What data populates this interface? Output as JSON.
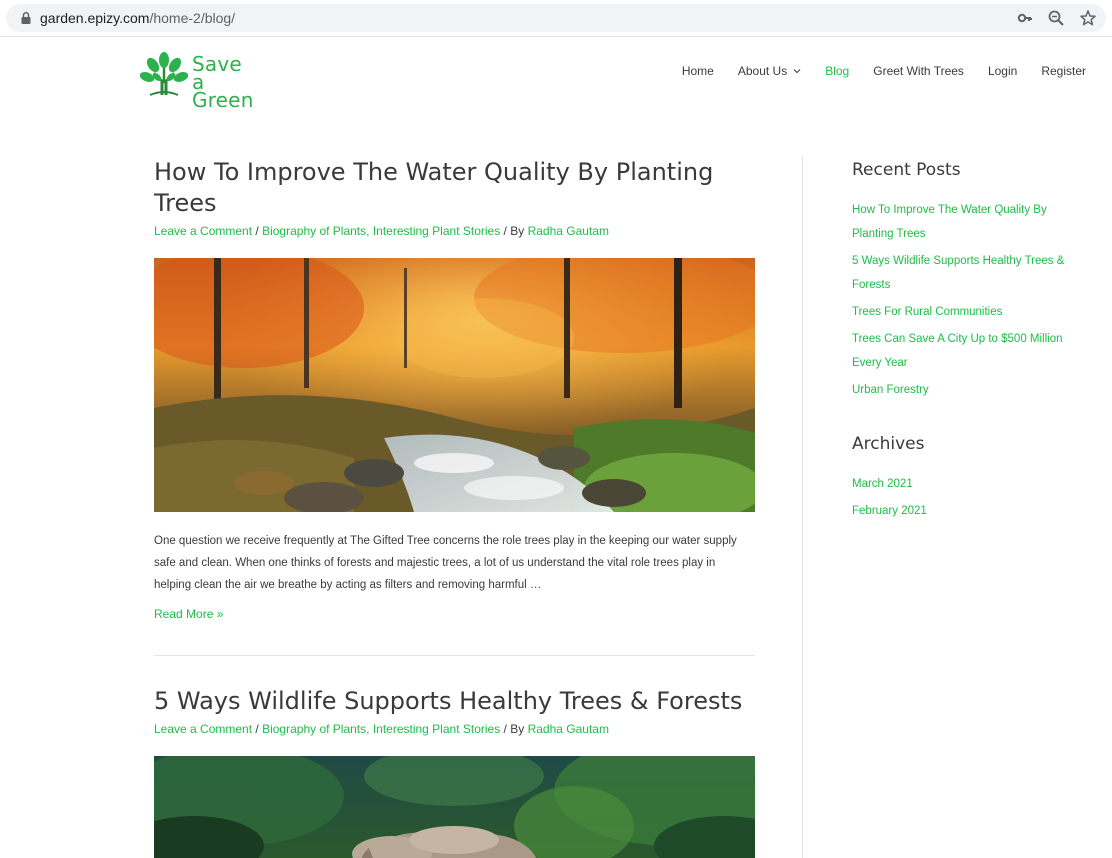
{
  "browser": {
    "url_domain": "garden.epizy.com",
    "url_path": "/home-2/blog/"
  },
  "site": {
    "logo_line1": "Save a",
    "logo_line2": "Green",
    "brand_color": "#2bb24c",
    "link_color": "#1fbd47"
  },
  "nav": {
    "items": [
      {
        "label": "Home"
      },
      {
        "label": "About Us"
      },
      {
        "label": "Blog"
      },
      {
        "label": "Greet With Trees"
      },
      {
        "label": "Login"
      },
      {
        "label": "Register"
      }
    ]
  },
  "posts": [
    {
      "title": "How To Improve The Water Quality By Planting Trees",
      "meta_comment": "Leave a Comment",
      "meta_sep1": " / ",
      "meta_cat1": "Biography of Plants",
      "meta_comma": ", ",
      "meta_cat2": "Interesting Plant Stories",
      "meta_by": " / By ",
      "meta_author": "Radha Gautam",
      "excerpt": "One question we receive frequently at The Gifted Tree concerns the role trees play in the keeping our water supply safe and clean. When one thinks of forests and majestic trees, a lot of us understand the vital role trees play in helping clean the air we breathe by acting as filters and removing harmful …",
      "read_more": "Read More »"
    },
    {
      "title": "5 Ways Wildlife Supports Healthy Trees & Forests",
      "meta_comment": "Leave a Comment",
      "meta_sep1": " / ",
      "meta_cat1": "Biography of Plants",
      "meta_comma": ", ",
      "meta_cat2": "Interesting Plant Stories",
      "meta_by": " / By ",
      "meta_author": "Radha Gautam"
    }
  ],
  "sidebar": {
    "recent_title": "Recent Posts",
    "recent": [
      "How To Improve The Water Quality By Planting Trees",
      "5 Ways Wildlife Supports Healthy Trees & Forests",
      "Trees For Rural Communities",
      "Trees Can Save A City Up to $500 Million Every Year",
      "Urban Forestry"
    ],
    "archives_title": "Archives",
    "archives": [
      "March 2021",
      "February 2021"
    ]
  }
}
